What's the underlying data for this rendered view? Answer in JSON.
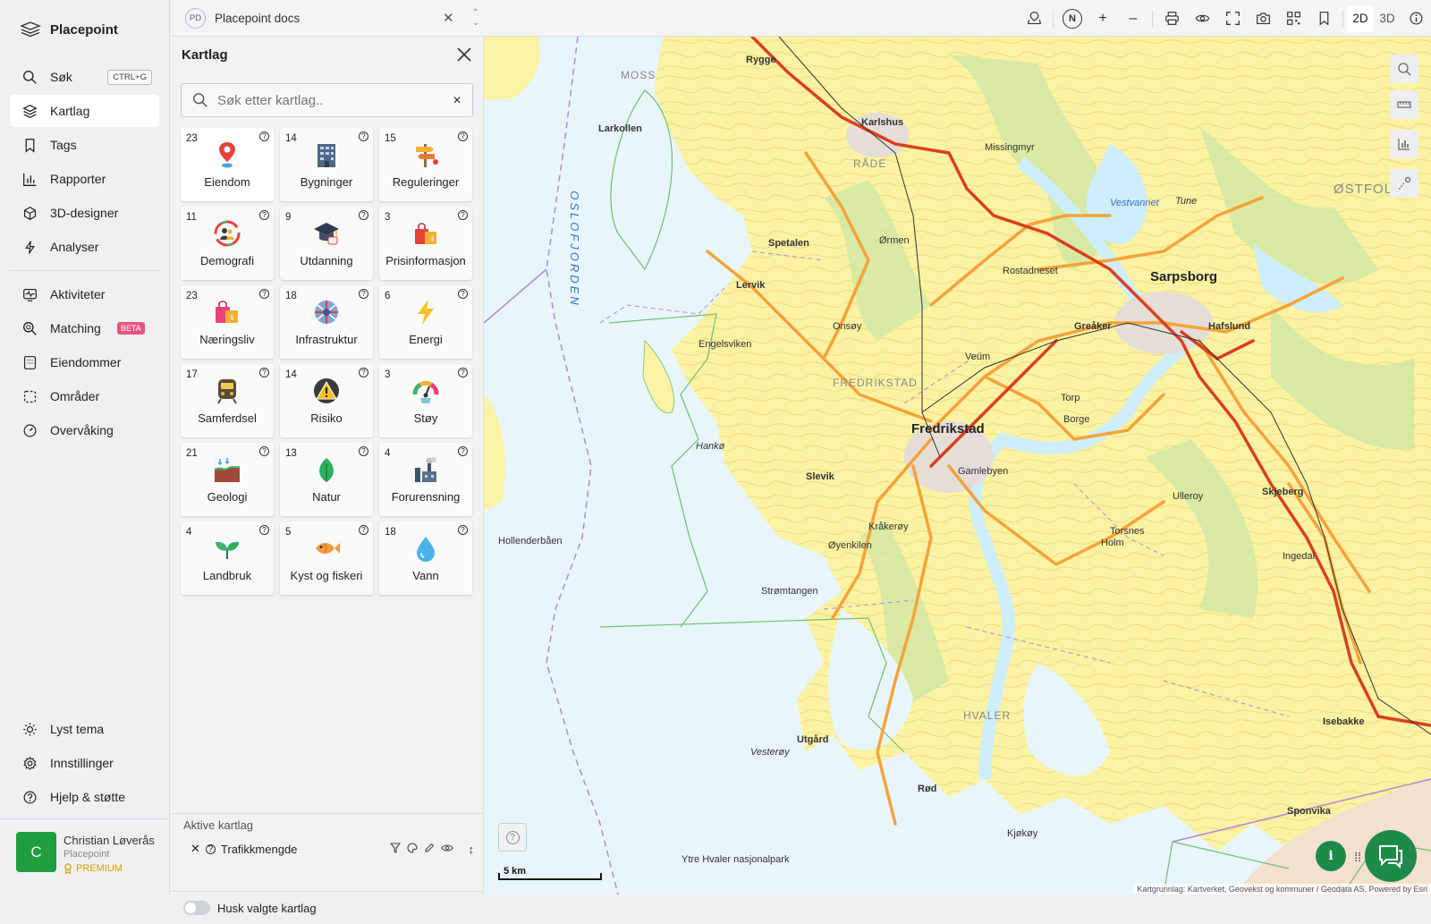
{
  "app": {
    "name": "Placepoint"
  },
  "sidebar": {
    "items": [
      {
        "label": "Søk",
        "shortcut": "CTRL+G",
        "icon": "search-icon"
      },
      {
        "label": "Kartlag",
        "icon": "layers-icon",
        "active": true
      },
      {
        "label": "Tags",
        "icon": "bookmark-icon"
      },
      {
        "label": "Rapporter",
        "icon": "bar-chart-icon"
      },
      {
        "label": "3D-designer",
        "icon": "cube-icon"
      },
      {
        "label": "Analyser",
        "icon": "lightning-icon"
      },
      {
        "label": "Aktiviteter",
        "icon": "activity-icon"
      },
      {
        "label": "Matching",
        "badge": "BETA",
        "icon": "zoom-search-icon"
      },
      {
        "label": "Eiendommer",
        "icon": "building-icon"
      },
      {
        "label": "Områder",
        "icon": "dashed-square-icon"
      },
      {
        "label": "Overvåking",
        "icon": "gauge-icon"
      }
    ],
    "bottom": [
      {
        "label": "Lyst tema",
        "icon": "sun-icon"
      },
      {
        "label": "Innstillinger",
        "icon": "gear-icon"
      },
      {
        "label": "Hjelp & støtte",
        "icon": "help-circle-icon"
      }
    ],
    "user": {
      "initial": "C",
      "name": "Christian Løverås",
      "org": "Placepoint",
      "plan": "PREMIUM"
    }
  },
  "topbar": {
    "workspace": {
      "badge": "PD",
      "name": "Placepoint docs"
    },
    "compass": "N",
    "zoom_in": "+",
    "zoom_out": "–",
    "mode_2d": "2D",
    "mode_3d": "3D"
  },
  "panel": {
    "title": "Kartlag",
    "search_placeholder": "Søk etter kartlag..",
    "categories": [
      {
        "count": "23",
        "label": "Eiendom",
        "icon": "location-pin-icon",
        "selected": true
      },
      {
        "count": "14",
        "label": "Bygninger",
        "icon": "office-building-icon"
      },
      {
        "count": "15",
        "label": "Reguleringer",
        "icon": "signpost-icon"
      },
      {
        "count": "11",
        "label": "Demografi",
        "icon": "people-circle-icon"
      },
      {
        "count": "9",
        "label": "Utdanning",
        "icon": "graduation-cap-icon"
      },
      {
        "count": "3",
        "label": "Prisinformasjon",
        "icon": "price-bag-icon"
      },
      {
        "count": "23",
        "label": "Næringsliv",
        "icon": "shopping-bags-icon"
      },
      {
        "count": "18",
        "label": "Infrastruktur",
        "icon": "infrastructure-globe-icon"
      },
      {
        "count": "6",
        "label": "Energi",
        "icon": "lightning-bolt-icon"
      },
      {
        "count": "17",
        "label": "Samferdsel",
        "icon": "train-icon"
      },
      {
        "count": "14",
        "label": "Risiko",
        "icon": "warning-sign-icon"
      },
      {
        "count": "3",
        "label": "Støy",
        "icon": "gauge-meter-icon"
      },
      {
        "count": "21",
        "label": "Geologi",
        "icon": "soil-layers-icon"
      },
      {
        "count": "13",
        "label": "Natur",
        "icon": "leaf-icon"
      },
      {
        "count": "4",
        "label": "Forurensning",
        "icon": "factory-icon"
      },
      {
        "count": "4",
        "label": "Landbruk",
        "icon": "sprout-icon"
      },
      {
        "count": "5",
        "label": "Kyst og fiskeri",
        "icon": "fish-icon"
      },
      {
        "count": "18",
        "label": "Vann",
        "icon": "water-drop-icon"
      }
    ],
    "active_title": "Aktive kartlag",
    "active_layers": [
      {
        "label": "Trafikkmengde"
      }
    ],
    "remember_label": "Husk valgte kartlag"
  },
  "map": {
    "labels": [
      {
        "text": "MOSS",
        "kind": "reg"
      },
      {
        "text": "Rygge",
        "kind": "normal"
      },
      {
        "text": "Larkollen",
        "kind": "normal"
      },
      {
        "text": "Karlshus",
        "kind": "normal"
      },
      {
        "text": "Missingmyr",
        "kind": "normal"
      },
      {
        "text": "RÅDE",
        "kind": "reg"
      },
      {
        "text": "OSLOFJORDEN",
        "kind": "water"
      },
      {
        "text": "Spetalen",
        "kind": "normal"
      },
      {
        "text": "Ørmen",
        "kind": "normal"
      },
      {
        "text": "Lervik",
        "kind": "normal"
      },
      {
        "text": "Rostadneset",
        "kind": "normal"
      },
      {
        "text": "Sarpsborg",
        "kind": "big"
      },
      {
        "text": "Onsøy",
        "kind": "normal"
      },
      {
        "text": "Engelsviken",
        "kind": "normal"
      },
      {
        "text": "Veum",
        "kind": "normal"
      },
      {
        "text": "Greåker",
        "kind": "normal"
      },
      {
        "text": "Hafslund",
        "kind": "normal"
      },
      {
        "text": "FREDRIKSTAD",
        "kind": "reg"
      },
      {
        "text": "Fredrikstad",
        "kind": "big"
      },
      {
        "text": "Torp",
        "kind": "normal"
      },
      {
        "text": "Borge",
        "kind": "normal"
      },
      {
        "text": "Skjeberg",
        "kind": "normal"
      },
      {
        "text": "Hankø",
        "kind": "normal"
      },
      {
        "text": "Gamlebyen",
        "kind": "normal"
      },
      {
        "text": "Slevik",
        "kind": "normal"
      },
      {
        "text": "Kråkerøy",
        "kind": "normal"
      },
      {
        "text": "Hollenderbåen",
        "kind": "normal"
      },
      {
        "text": "Øyenkilen",
        "kind": "normal"
      },
      {
        "text": "Strømtangen",
        "kind": "normal"
      },
      {
        "text": "HVALER",
        "kind": "reg"
      },
      {
        "text": "Vesterøy",
        "kind": "normal"
      },
      {
        "text": "Utgård",
        "kind": "normal"
      },
      {
        "text": "Ytre Hvaler nasjonalpark",
        "kind": "normal"
      },
      {
        "text": "Sponvika",
        "kind": "normal"
      },
      {
        "text": "Isebakke",
        "kind": "normal"
      },
      {
        "text": "Ingedal",
        "kind": "normal"
      },
      {
        "text": "ØSTFOLD",
        "kind": "reg"
      },
      {
        "text": "Tune",
        "kind": "normal"
      },
      {
        "text": "Vestvannet",
        "kind": "water"
      },
      {
        "text": "Kjøkøy",
        "kind": "normal"
      },
      {
        "text": "Rød",
        "kind": "normal"
      },
      {
        "text": "Holm",
        "kind": "normal"
      },
      {
        "text": "Ulleroy",
        "kind": "normal"
      },
      {
        "text": "Torsnes",
        "kind": "normal"
      }
    ],
    "scale_label": "5 km",
    "attribution": "Kartgrunnlag: Kartverket, Geovekst og kommuner / Geodata AS, Powered by Esri"
  }
}
